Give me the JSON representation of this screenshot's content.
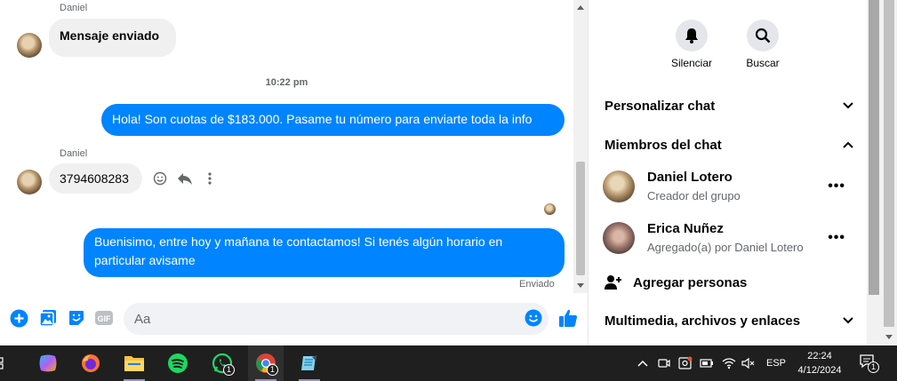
{
  "messages": {
    "m1_sender": "Daniel",
    "m1_text": "Mensaje enviado",
    "timestamp": "10:22 pm",
    "m2_text": "Hola! Son cuotas de $183.000. Pasame tu número para enviarte toda la info",
    "m3_sender": "Daniel",
    "m3_text": "3794608283",
    "m4_text": "Buenisimo, entre hoy y mañana te contactamos! Si tenés algún horario en particular avisame",
    "m4_status": "Enviado"
  },
  "composer": {
    "placeholder": "Aa"
  },
  "panel": {
    "mute_label": "Silenciar",
    "search_label": "Buscar",
    "customize_label": "Personalizar chat",
    "members_label": "Miembros del chat",
    "members": [
      {
        "name": "Daniel Lotero",
        "role": "Creador del grupo"
      },
      {
        "name": "Erica Nuñez",
        "role": "Agregado(a) por Daniel Lotero"
      }
    ],
    "add_people_label": "Agregar personas",
    "media_label": "Multimedia, archivos y enlaces"
  },
  "taskbar": {
    "apps": [
      "copilot-icon",
      "firefox-icon",
      "file-explorer-icon",
      "spotify-icon",
      "whatsapp-icon",
      "chrome-icon",
      "notepad-icon"
    ],
    "whatsapp_badge": "1",
    "chrome_badge": "1",
    "lang": "ESP",
    "time": "22:24",
    "date": "4/12/2024",
    "notification_count": "1"
  },
  "colors": {
    "accent": "#0084ff",
    "bubble_in": "#f0f0f0",
    "taskbar": "#1f1f1f"
  }
}
